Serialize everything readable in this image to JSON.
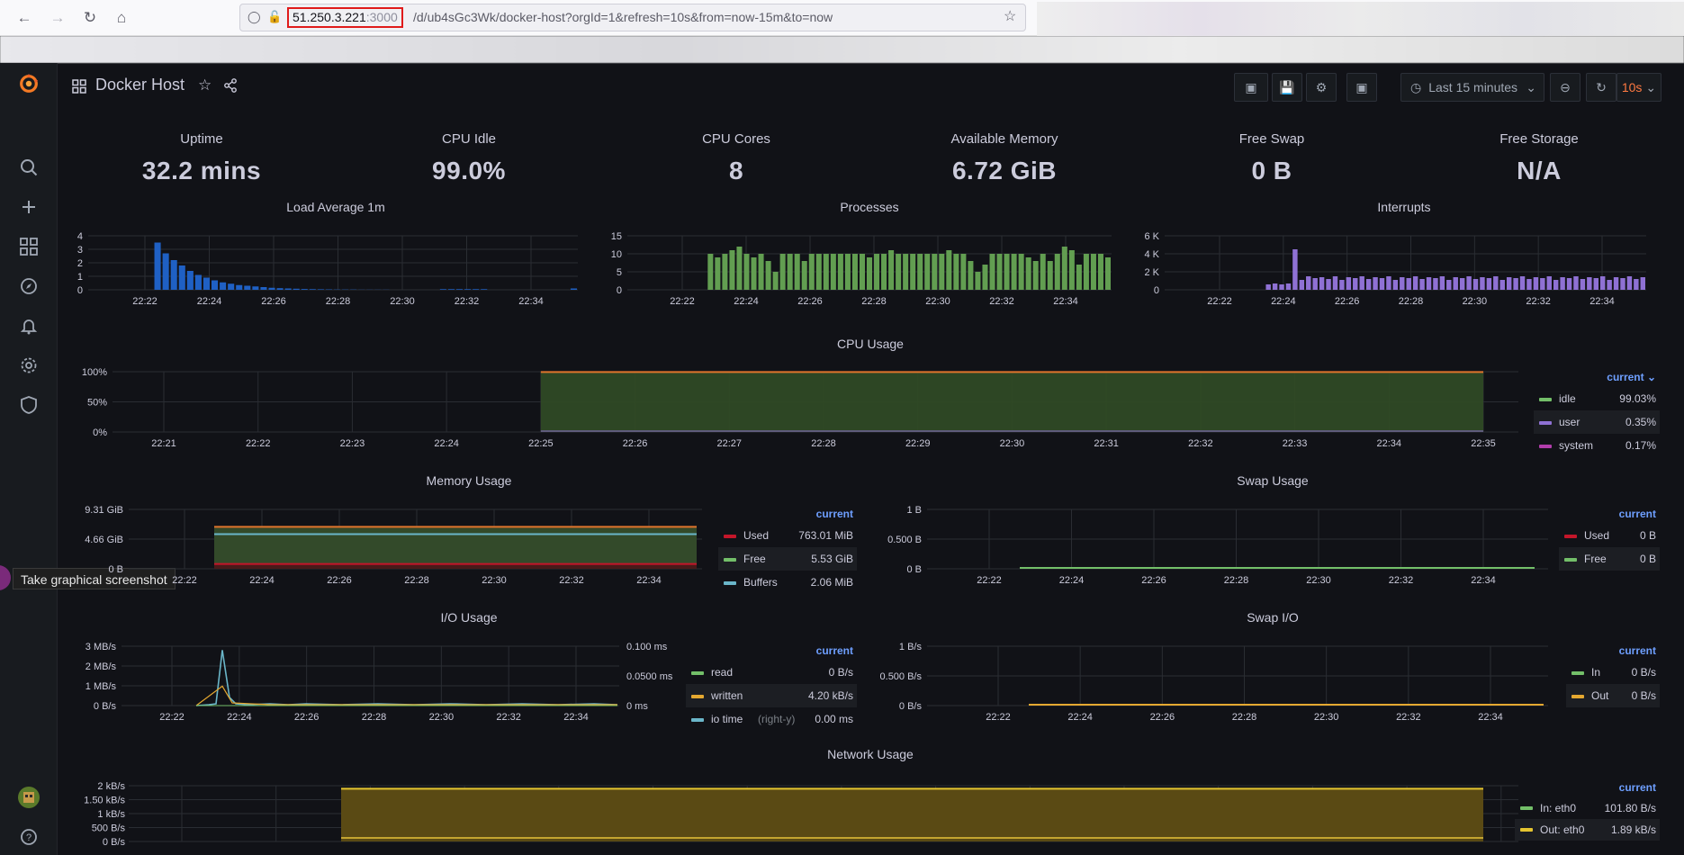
{
  "browser": {
    "url_host": "51.250.3.221",
    "url_port": ":3000",
    "url_path": "/d/ub4sGc3Wk/docker-host?orgId=1&refresh=10s&from=now-15m&to=now"
  },
  "dashboard": {
    "title": "Docker Host",
    "time_range": "Last 15 minutes",
    "refresh": "10s"
  },
  "tooltip": "Take graphical screenshot",
  "stats": [
    {
      "title": "Uptime",
      "value": "32.2 mins"
    },
    {
      "title": "CPU Idle",
      "value": "99.0%"
    },
    {
      "title": "CPU Cores",
      "value": "8"
    },
    {
      "title": "Available Memory",
      "value": "6.72 GiB"
    },
    {
      "title": "Free Swap",
      "value": "0 B"
    },
    {
      "title": "Free Storage",
      "value": "N/A"
    }
  ],
  "panels": {
    "load": {
      "title": "Load Average 1m"
    },
    "processes": {
      "title": "Processes"
    },
    "interrupts": {
      "title": "Interrupts"
    },
    "cpu": {
      "title": "CPU Usage"
    },
    "memory": {
      "title": "Memory Usage"
    },
    "swap": {
      "title": "Swap Usage"
    },
    "io": {
      "title": "I/O Usage"
    },
    "swapio": {
      "title": "Swap I/O"
    },
    "network": {
      "title": "Network Usage"
    }
  },
  "legends": {
    "current_label": "current",
    "cpu": [
      {
        "name": "idle",
        "value": "99.03%",
        "color": "#73bf69"
      },
      {
        "name": "user",
        "value": "0.35%",
        "color": "#8f71d4"
      },
      {
        "name": "system",
        "value": "0.17%",
        "color": "#b13dab"
      }
    ],
    "memory": [
      {
        "name": "Used",
        "value": "763.01 MiB",
        "color": "#c4162a"
      },
      {
        "name": "Free",
        "value": "5.53 GiB",
        "color": "#73bf69"
      },
      {
        "name": "Buffers",
        "value": "2.06 MiB",
        "color": "#6ab6c9"
      }
    ],
    "swap": [
      {
        "name": "Used",
        "value": "0 B",
        "color": "#c4162a"
      },
      {
        "name": "Free",
        "value": "0 B",
        "color": "#73bf69"
      }
    ],
    "io": [
      {
        "name": "read",
        "suffix": "",
        "value": "0 B/s",
        "color": "#73bf69"
      },
      {
        "name": "written",
        "suffix": "",
        "value": "4.20 kB/s",
        "color": "#e5a830"
      },
      {
        "name": "io time",
        "suffix": "(right-y)",
        "value": "0.00 ms",
        "color": "#6ab6c9"
      }
    ],
    "swapio": [
      {
        "name": "In",
        "value": "0 B/s",
        "color": "#73bf69"
      },
      {
        "name": "Out",
        "value": "0 B/s",
        "color": "#e5a830"
      }
    ],
    "network": [
      {
        "name": "In: eth0",
        "value": "101.80 B/s",
        "color": "#73bf69"
      },
      {
        "name": "Out: eth0",
        "value": "1.89 kB/s",
        "color": "#e5c530"
      }
    ]
  },
  "chart_data": [
    {
      "type": "bar",
      "title": "Load Average 1m",
      "y_ticks": [
        "0",
        "1",
        "2",
        "3",
        "4"
      ],
      "ylim": [
        0,
        4
      ],
      "x_ticks": [
        "22:22",
        "22:24",
        "22:26",
        "22:28",
        "22:30",
        "22:32",
        "22:34"
      ],
      "values": [
        0,
        0,
        0,
        0,
        0,
        0,
        0,
        0,
        3.5,
        2.7,
        2.2,
        1.8,
        1.4,
        1.1,
        0.9,
        0.7,
        0.55,
        0.45,
        0.35,
        0.3,
        0.25,
        0.2,
        0.15,
        0.12,
        0.1,
        0.08,
        0.06,
        0.05,
        0.04,
        0.03,
        0.02,
        0.02,
        0.02,
        0.01,
        0.01,
        0.01,
        0.01,
        0,
        0,
        0,
        0,
        0,
        0,
        0.05,
        0.05,
        0.05,
        0.05,
        0.05,
        0.05,
        0,
        0,
        0,
        0,
        0,
        0,
        0,
        0,
        0,
        0,
        0.1
      ],
      "color": "#1f60c4"
    },
    {
      "type": "bar",
      "title": "Processes",
      "y_ticks": [
        "0",
        "5",
        "10",
        "15"
      ],
      "ylim": [
        0,
        15
      ],
      "x_ticks": [
        "22:22",
        "22:24",
        "22:26",
        "22:28",
        "22:30",
        "22:32",
        "22:34"
      ],
      "values": [
        0,
        0,
        0,
        0,
        0,
        0,
        0,
        0,
        0,
        0,
        0,
        10,
        9,
        10,
        11,
        12,
        10,
        9,
        10,
        8,
        5,
        10,
        10,
        10,
        8,
        10,
        10,
        10,
        10,
        10,
        10,
        10,
        10,
        9,
        10,
        10,
        11,
        10,
        10,
        10,
        10,
        10,
        10,
        10,
        11,
        10,
        10,
        8,
        5,
        7,
        10,
        10,
        10,
        10,
        10,
        9,
        8,
        10,
        8,
        10,
        12,
        11,
        7,
        10,
        10,
        10,
        9
      ],
      "color": "#629e51"
    },
    {
      "type": "bar",
      "title": "Interrupts",
      "y_ticks": [
        "0",
        "2 K",
        "4 K",
        "6 K"
      ],
      "ylim": [
        0,
        6000
      ],
      "x_ticks": [
        "22:22",
        "22:24",
        "22:26",
        "22:28",
        "22:30",
        "22:32",
        "22:34"
      ],
      "values": [
        0,
        0,
        0,
        0,
        0,
        0,
        0,
        0,
        0,
        0,
        0,
        0,
        0,
        0,
        0,
        600,
        700,
        600,
        700,
        4500,
        1100,
        1500,
        1300,
        1400,
        1200,
        1500,
        1100,
        1400,
        1300,
        1500,
        1200,
        1400,
        1300,
        1500,
        1100,
        1400,
        1300,
        1500,
        1200,
        1400,
        1300,
        1500,
        1100,
        1400,
        1300,
        1500,
        1200,
        1400,
        1300,
        1500,
        1100,
        1400,
        1300,
        1500,
        1200,
        1400,
        1300,
        1500,
        1100,
        1400,
        1300,
        1500,
        1200,
        1400,
        1300,
        1500,
        1100,
        1400,
        1300,
        1500,
        1200,
        1400
      ],
      "color": "#8f71d4"
    },
    {
      "type": "area",
      "title": "CPU Usage",
      "y_ticks": [
        "0%",
        "50%",
        "100%"
      ],
      "ylim": [
        0,
        100
      ],
      "x_ticks": [
        "22:21",
        "22:22",
        "22:23",
        "22:24",
        "22:25",
        "22:26",
        "22:27",
        "22:28",
        "22:29",
        "22:30",
        "22:31",
        "22:32",
        "22:33",
        "22:34",
        "22:35"
      ],
      "x_start": "22:25",
      "x_end": "22:35",
      "series": [
        {
          "name": "idle",
          "value": 99
        },
        {
          "name": "user",
          "value": 0.35
        },
        {
          "name": "system",
          "value": 0.17
        }
      ]
    },
    {
      "type": "area",
      "title": "Memory Usage",
      "y_ticks": [
        "0 B",
        "4.66 GiB",
        "9.31 GiB"
      ],
      "ylim": [
        0,
        9.31
      ],
      "x_ticks": [
        "22:22",
        "22:24",
        "22:26",
        "22:28",
        "22:30",
        "22:32",
        "22:34"
      ],
      "series": [
        {
          "name": "Used",
          "value": 0.75
        },
        {
          "name": "Free",
          "value": 5.53
        },
        {
          "name": "Buffers",
          "value": 0.002
        }
      ]
    },
    {
      "type": "line",
      "title": "Swap Usage",
      "y_ticks": [
        "0 B",
        "0.500 B",
        "1 B"
      ],
      "ylim": [
        0,
        1
      ],
      "x_ticks": [
        "22:22",
        "22:24",
        "22:26",
        "22:28",
        "22:30",
        "22:32",
        "22:34"
      ],
      "series": [
        {
          "name": "Used",
          "value": 0
        },
        {
          "name": "Free",
          "value": 0
        }
      ]
    },
    {
      "type": "line",
      "title": "I/O Usage",
      "y_ticks": [
        "0 B/s",
        "1 MB/s",
        "2 MB/s",
        "3 MB/s"
      ],
      "ylim": [
        0,
        3
      ],
      "y2_ticks": [
        "0 ms",
        "0.0500 ms",
        "0.100 ms"
      ],
      "x_ticks": [
        "22:22",
        "22:24",
        "22:26",
        "22:28",
        "22:30",
        "22:32",
        "22:34"
      ],
      "series": [
        {
          "name": "io time",
          "spike_at": "22:23.5",
          "peak": 2.8
        }
      ]
    },
    {
      "type": "line",
      "title": "Swap I/O",
      "y_ticks": [
        "0 B/s",
        "0.500 B/s",
        "1 B/s"
      ],
      "ylim": [
        0,
        1
      ],
      "x_ticks": [
        "22:22",
        "22:24",
        "22:26",
        "22:28",
        "22:30",
        "22:32",
        "22:34"
      ],
      "series": [
        {
          "name": "In",
          "value": 0
        },
        {
          "name": "Out",
          "value": 0
        }
      ]
    },
    {
      "type": "area",
      "title": "Network Usage",
      "y_ticks": [
        "0 B/s",
        "500 B/s",
        "1 kB/s",
        "1.50 kB/s",
        "2 kB/s"
      ],
      "ylim": [
        0,
        2000
      ],
      "series": [
        {
          "name": "In: eth0",
          "value": 101.8
        },
        {
          "name": "Out: eth0",
          "value": 1890
        }
      ]
    }
  ]
}
